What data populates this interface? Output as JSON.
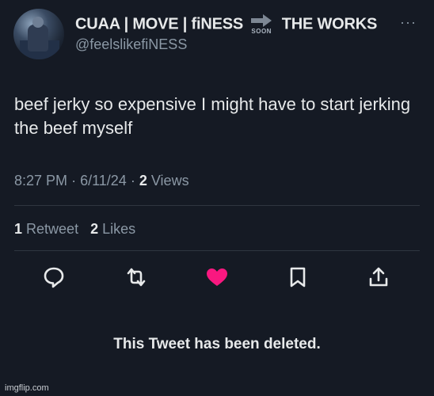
{
  "author": {
    "name_part1": "CUAA | MOVE | fiNESS",
    "arrow_label": "SOON",
    "name_part2": "THE WORKS",
    "handle": "@feelslikefiNESS"
  },
  "tweet": {
    "text": "beef jerky so expensive I might have to start jerking the beef myself",
    "time": "8:27 PM",
    "date": "6/11/24",
    "views_count": "2",
    "views_label": "Views"
  },
  "stats": {
    "retweets_count": "1",
    "retweets_label": "Retweet",
    "likes_count": "2",
    "likes_label": "Likes"
  },
  "actions": [
    "reply-icon",
    "retweet-icon",
    "like-icon",
    "bookmark-icon",
    "share-icon"
  ],
  "colors": {
    "background": "#151a24",
    "text": "#e7e9ea",
    "muted": "#8b98a5",
    "like": "#f91880"
  },
  "notice": "This Tweet has been deleted.",
  "watermark": "imgflip.com",
  "more_glyph": "···",
  "separator": "·"
}
